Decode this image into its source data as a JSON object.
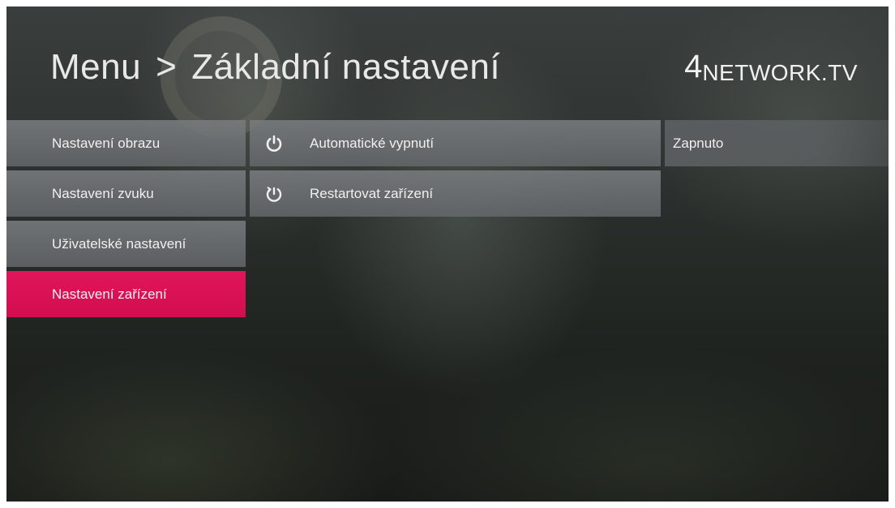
{
  "header": {
    "menu_label": "Menu",
    "separator": ">",
    "section_title": "Základní nastavení"
  },
  "logo": {
    "number": "4",
    "word": "NETWORK.TV"
  },
  "categories": [
    {
      "label": "Nastavení obrazu",
      "active": false
    },
    {
      "label": "Nastavení zvuku",
      "active": false
    },
    {
      "label": "Uživatelské nastavení",
      "active": false
    },
    {
      "label": "Nastavení zařízení",
      "active": true
    }
  ],
  "options": [
    {
      "label": "Automatické vypnutí",
      "icon": "power-icon"
    },
    {
      "label": "Restartovat zařízení",
      "icon": "restart-icon"
    }
  ],
  "option_value": {
    "label": "Zapnuto"
  },
  "colors": {
    "accent": "#e0155a",
    "row_bg": "#7a7e80",
    "text": "#f0f0f0"
  }
}
